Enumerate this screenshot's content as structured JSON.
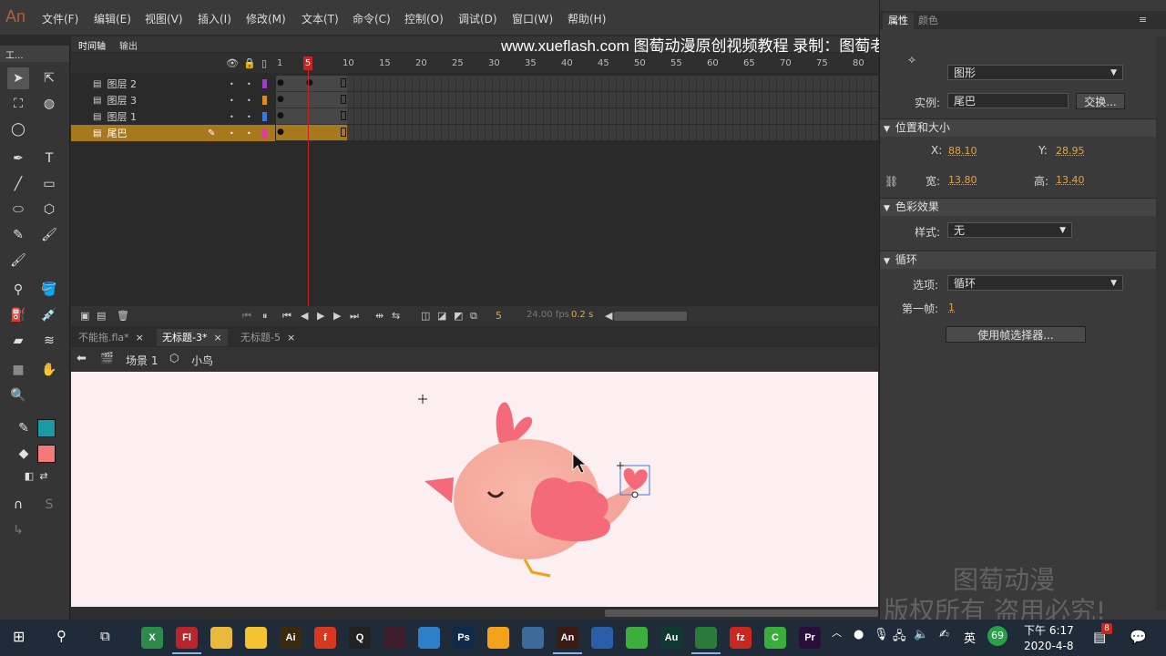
{
  "app": {
    "logo": "An"
  },
  "menu": [
    "文件(F)",
    "编辑(E)",
    "视图(V)",
    "插入(I)",
    "修改(M)",
    "文本(T)",
    "命令(C)",
    "控制(O)",
    "调试(D)",
    "窗口(W)",
    "帮助(H)"
  ],
  "banner": "www.xueflash.com  图萄动漫原创视频教程  录制：图萄老师   微信：xueflash",
  "toolbox": {
    "title": "工..."
  },
  "timeline": {
    "tabs": [
      "时间轴",
      "输出"
    ],
    "frame_numbers": [
      "1",
      "5",
      "10",
      "15",
      "20",
      "25",
      "30",
      "35",
      "40",
      "45",
      "50",
      "55",
      "60",
      "65",
      "70",
      "75",
      "80"
    ],
    "current_frame": "5",
    "layers": [
      {
        "name": "图层 2",
        "color": "#a03cc8"
      },
      {
        "name": "图层 3",
        "color": "#e08a1e"
      },
      {
        "name": "图层 1",
        "color": "#3c78dc"
      },
      {
        "name": "尾巴",
        "color": "#e03ca0"
      }
    ],
    "fps": "24.00 fps",
    "time": "0.2 s",
    "frame_readout": "5"
  },
  "doc_tabs": [
    {
      "label": "不能拖.fla*",
      "active": false
    },
    {
      "label": "无标题-3*",
      "active": true
    },
    {
      "label": "无标题-5",
      "active": false
    }
  ],
  "breadcrumb": {
    "scene": "场景 1",
    "symbol": "小鸟"
  },
  "properties": {
    "tabs": [
      "属性",
      "颜色"
    ],
    "type": "图形",
    "instance_label": "实例:",
    "instance_name": "尾巴",
    "swap_label": "交换...",
    "pos_size_title": "位置和大小",
    "x_label": "X:",
    "x": "88.10",
    "y_label": "Y:",
    "y": "28.95",
    "w_label": "宽:",
    "w": "13.80",
    "h_label": "高:",
    "h": "13.40",
    "color_effect_title": "色彩效果",
    "style_label": "样式:",
    "style": "无",
    "loop_title": "循环",
    "option_label": "选项:",
    "option": "循环",
    "first_frame_label": "第一帧:",
    "first_frame": "1",
    "frame_picker_label": "使用帧选择器...",
    "watermark_line1": "图萄动漫",
    "watermark_line2": "版权所有 盗用必究!"
  },
  "taskbar": {
    "time": "下午 6:17",
    "date": "2020-4-8",
    "ime": "英",
    "badge": "69",
    "notify": "8",
    "icons": [
      {
        "name": "xmind-icon",
        "text": "X",
        "color": "#2c8a4a"
      },
      {
        "name": "flash-icon",
        "text": "Fl",
        "color": "#b8252c"
      },
      {
        "name": "folder-icon",
        "text": "",
        "color": "#e8b93c"
      },
      {
        "name": "bird-app-icon",
        "text": "",
        "color": "#f2c230"
      },
      {
        "name": "illustrator-icon",
        "text": "Ai",
        "color": "#3a2a10"
      },
      {
        "name": "flash-player-icon",
        "text": "f",
        "color": "#d8391e"
      },
      {
        "name": "qq-icon",
        "text": "Q",
        "color": "#222222"
      },
      {
        "name": "media-encoder-icon",
        "text": "",
        "color": "#3d1e2a"
      },
      {
        "name": "globe-icon",
        "text": "",
        "color": "#2f7ec8"
      },
      {
        "name": "photoshop-icon",
        "text": "Ps",
        "color": "#0f2a4a"
      },
      {
        "name": "refresh-icon",
        "text": "",
        "color": "#f2a31a"
      },
      {
        "name": "eye-app-icon",
        "text": "",
        "color": "#3c6a9a"
      },
      {
        "name": "animate-icon",
        "text": "An",
        "color": "#3a1a12"
      },
      {
        "name": "network-icon",
        "text": "",
        "color": "#2a5ea8"
      },
      {
        "name": "sync-icon",
        "text": "",
        "color": "#3cae3c"
      },
      {
        "name": "audition-icon",
        "text": "Au",
        "color": "#0f3a32"
      },
      {
        "name": "pinwheel-icon",
        "text": "",
        "color": "#2a7a3a"
      },
      {
        "name": "filezilla-icon",
        "text": "fz",
        "color": "#c8281e"
      },
      {
        "name": "camtasia-icon",
        "text": "C",
        "color": "#3aae3a"
      },
      {
        "name": "premiere-icon",
        "text": "Pr",
        "color": "#2a0f3a"
      }
    ]
  }
}
